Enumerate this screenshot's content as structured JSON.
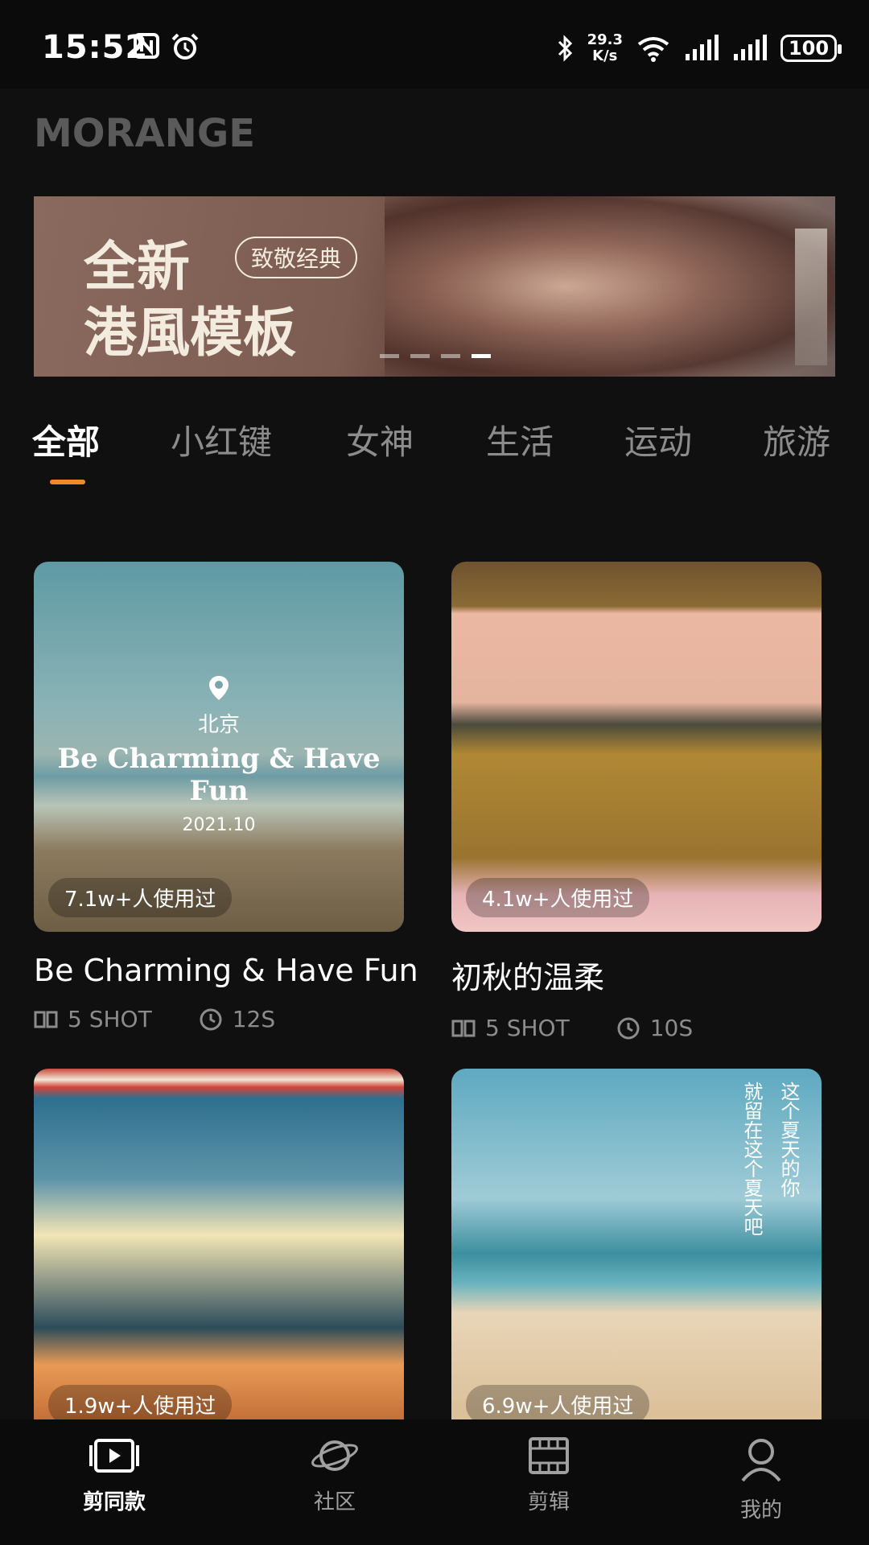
{
  "status_bar": {
    "time": "15:52",
    "speed_value": "29.3",
    "speed_unit": "K/s",
    "battery": "100"
  },
  "app": {
    "logo_text": "MORANGE"
  },
  "banner": {
    "title_line1": "全新",
    "badge": "致敬经典",
    "title_line2": "港風模板",
    "page_count": 4,
    "active_page": 4
  },
  "tabs": [
    {
      "label": "全部",
      "active": true
    },
    {
      "label": "小红键",
      "active": false
    },
    {
      "label": "女神",
      "active": false
    },
    {
      "label": "生活",
      "active": false
    },
    {
      "label": "运动",
      "active": false
    },
    {
      "label": "旅游",
      "active": false
    }
  ],
  "cards": [
    {
      "uses": "7.1w+人使用过",
      "title": "Be Charming & Have Fun",
      "shots": "5 SHOT",
      "duration": "12S",
      "overlay": {
        "city": "北京",
        "title": "Be Charming & Have Fun",
        "date": "2021.10"
      }
    },
    {
      "uses": "4.1w+人使用过",
      "title": "初秋的温柔",
      "shots": "5 SHOT",
      "duration": "10S"
    },
    {
      "uses": "1.9w+人使用过"
    },
    {
      "uses": "6.9w+人使用过",
      "vertical_text": [
        "这个夏天的你",
        "就留在这个夏天吧"
      ]
    }
  ],
  "bottom_nav": [
    {
      "label": "剪同款",
      "icon": "video-template-icon",
      "active": true
    },
    {
      "label": "社区",
      "icon": "planet-icon",
      "active": false
    },
    {
      "label": "剪辑",
      "icon": "film-icon",
      "active": false
    },
    {
      "label": "我的",
      "icon": "user-icon",
      "active": false
    }
  ],
  "colors": {
    "accent": "#f0892b",
    "background": "#101010",
    "inactive_tab": "#8c8c8c"
  }
}
